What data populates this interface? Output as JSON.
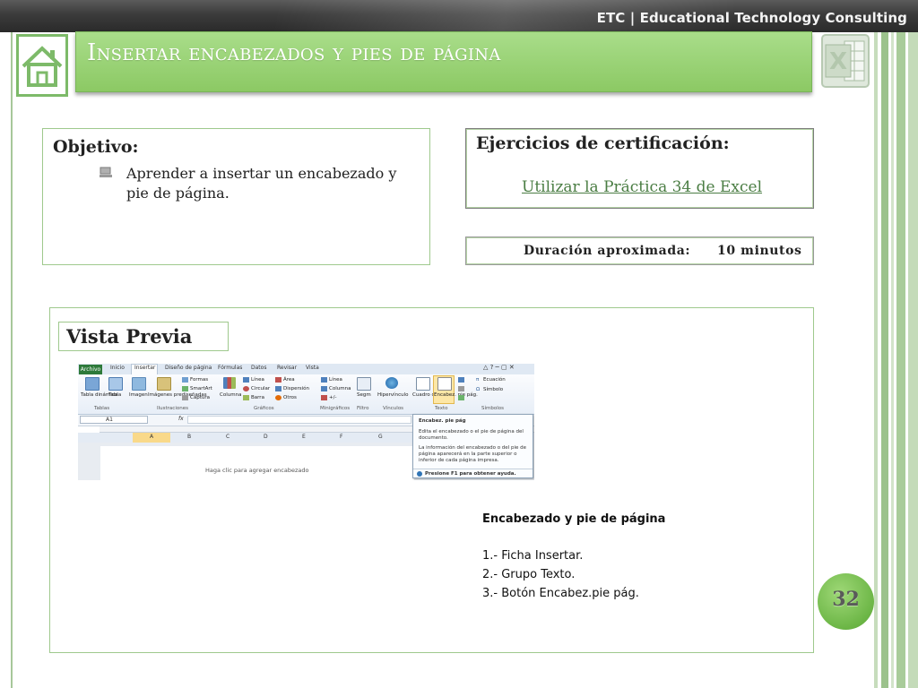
{
  "header": {
    "brand": "ETC | Educational Technology Consulting",
    "title": "Insertar encabezados y pies de página"
  },
  "objective": {
    "heading": "Objetivo:",
    "text": "Aprender a insertar un encabezado y pie de página."
  },
  "certification": {
    "heading": "Ejercicios de  certificación:",
    "link": "Utilizar la Práctica 34 de Excel"
  },
  "duration": {
    "label": "Duración aproximada:",
    "value": "10 minutos"
  },
  "preview": {
    "heading": "Vista Previa",
    "excel": {
      "tabs": [
        "Archivo",
        "Inicio",
        "Insertar",
        "Diseño de página",
        "Fórmulas",
        "Datos",
        "Revisar",
        "Vista"
      ],
      "groups": [
        "Tablas",
        "Ilustraciones",
        "Gráficos",
        "Minigráficos",
        "Filtro",
        "Vínculos",
        "Texto",
        "Símbolos"
      ],
      "buttons": {
        "pivot": "Tabla dinámica",
        "table": "Tabla",
        "image": "Imagen",
        "clipart": "Imágenes prediseñadas",
        "shapes": "Formas",
        "smartart": "SmartArt",
        "capture": "Captura",
        "column": "Columna",
        "line": "Línea",
        "pie": "Circular",
        "bar": "Barra",
        "area": "Área",
        "scatter": "Dispersión",
        "others": "Otros",
        "spark_line": "Línea",
        "spark_column": "Columna",
        "spark_winloss": "+/-",
        "slicer": "Segm",
        "hyperlink": "Hipervínculo",
        "textbox": "Cuadro de texto",
        "header_footer": "Encabez. pie pág.",
        "equation": "Ecuación",
        "symbol": "Símbolo"
      },
      "name_box": "A1",
      "fx": "fx",
      "columns": [
        "A",
        "B",
        "C",
        "D",
        "E",
        "F",
        "G"
      ],
      "header_placeholder": "Haga clic para agregar encabezado",
      "tooltip": {
        "title": "Encabez. pie pág",
        "line1": "Edita el encabezado o el pie de página del documento.",
        "line2": "La información del encabezado o del pie de página aparecerá en la parte superior o inferior de cada página impresa.",
        "help": "Presione F1 para obtener ayuda."
      }
    }
  },
  "instructions": {
    "title": "Encabezado y pie de página",
    "steps": [
      "1.- Ficha Insertar.",
      "2.- Grupo Texto.",
      "3.- Botón Encabez.pie pág."
    ]
  },
  "page_number": "32",
  "colors": {
    "accent_green": "#8cc964",
    "border_green": "#9fc98d",
    "link_green": "#4a7d43",
    "excel_green": "#2e7a3a"
  }
}
